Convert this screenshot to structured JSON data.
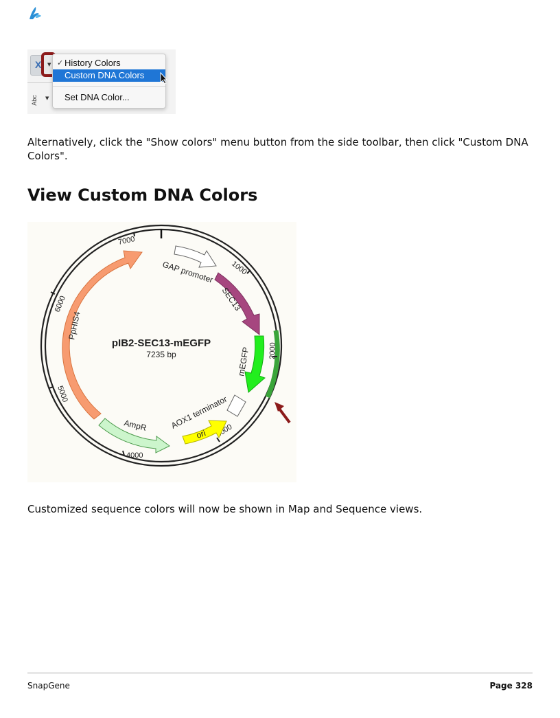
{
  "logo": {
    "icon": "snapgene-logo-icon",
    "color": "#2a8fd6"
  },
  "menu": {
    "items": [
      "History Colors",
      "Custom DNA Colors",
      "Set DNA Color..."
    ],
    "selected_index": 1,
    "toolbar_icon_label": "Abc"
  },
  "paragraph1": "Alternatively, click the \"Show colors\" menu button from the side toolbar, then click \"Custom DNA Colors\".",
  "heading": "View Custom DNA Colors",
  "plasmid": {
    "name": "pIB2-SEC13-mEGFP",
    "size": "7235 bp",
    "ticks": [
      "1000",
      "2000",
      "3000",
      "4000",
      "5000",
      "6000",
      "7000"
    ],
    "features": [
      {
        "label": "GAP promoter",
        "color": "#ffffff"
      },
      {
        "label": "SEC13",
        "color": "#a6467f"
      },
      {
        "label": "mEGFP",
        "color": "#22ee1e"
      },
      {
        "label": "AOX1 terminator",
        "color": "#ffffff"
      },
      {
        "label": "ori",
        "color": "#ffff00"
      },
      {
        "label": "AmpR",
        "color": "#ccf5cc"
      },
      {
        "label": "PpHIS4",
        "color": "#f79b70"
      }
    ],
    "highlight_color": "#3aa53a",
    "arrow_color": "#8c1b1b"
  },
  "paragraph2": "Customized sequence colors will now be shown in Map and Sequence views.",
  "footer": {
    "left": "SnapGene",
    "right": "Page 328"
  }
}
